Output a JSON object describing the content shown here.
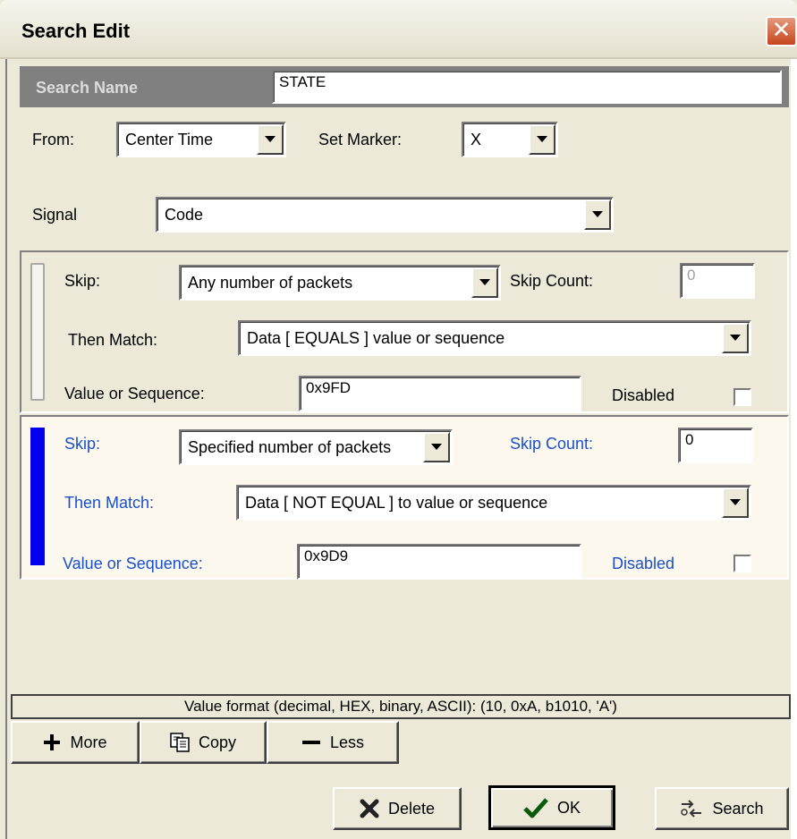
{
  "window": {
    "title": "Search Edit",
    "close_glyph": "✕"
  },
  "search_name": {
    "label": "Search Name",
    "value": "STATE"
  },
  "from": {
    "label": "From:",
    "value": "Center Time"
  },
  "set_marker": {
    "label": "Set Marker:",
    "value": "X"
  },
  "signal": {
    "label": "Signal",
    "value": "Code"
  },
  "clauses": [
    {
      "selected": false,
      "skip_label": "Skip:",
      "skip_value": "Any number of packets",
      "skip_count_label": "Skip Count:",
      "skip_count": "0",
      "skip_count_enabled": false,
      "then_match_label": "Then Match:",
      "then_match_value": "Data [ EQUALS ] value or sequence",
      "value_label": "Value or Sequence:",
      "value": "0x9FD",
      "disabled_label": "Disabled",
      "disabled": false
    },
    {
      "selected": true,
      "skip_label": "Skip:",
      "skip_value": "Specified number of packets",
      "skip_count_label": "Skip Count:",
      "skip_count": "0",
      "skip_count_enabled": true,
      "then_match_label": "Then Match:",
      "then_match_value": "Data [ NOT EQUAL ] to value or sequence",
      "value_label": "Value or Sequence:",
      "value": "0x9D9",
      "disabled_label": "Disabled",
      "disabled": false
    }
  ],
  "hint": "Value format (decimal, HEX, binary, ASCII):  (10, 0xA, b1010, 'A')",
  "toolbar": {
    "more_label": "More",
    "copy_label": "Copy",
    "less_label": "Less"
  },
  "actions": {
    "delete_label": "Delete",
    "ok_label": "OK",
    "search_label": "Search"
  },
  "colors": {
    "selected_clause_bar": "#0000ee",
    "label_blue": "#1a4fc9",
    "name_bar": "#808080",
    "face": "#ece9d8"
  },
  "icons": {
    "close": "close-icon",
    "dropdown": "chevron-down-icon",
    "more": "plus-icon",
    "copy": "copy-icon",
    "less": "minus-icon",
    "delete": "x-mark-icon",
    "ok": "checkmark-icon",
    "search": "search-icon"
  }
}
